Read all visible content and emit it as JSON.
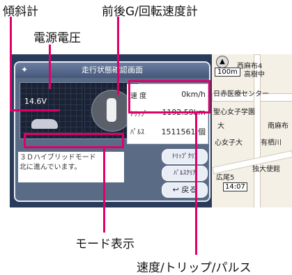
{
  "callouts": {
    "tilt_meter": "傾斜計",
    "g_meter": "前後G/回転速度計",
    "voltage": "電源電圧",
    "mode_display": "モード表示",
    "speed_trip_pulse": "速度/トリップ/パルス"
  },
  "panel": {
    "title": "走行状態確認画面",
    "voltage_value": "14.6V",
    "speed_label": "速 度",
    "speed_value": "0km/h",
    "trip_label": "ﾄﾘｯﾌﾟ",
    "trip_value": "1192.59km",
    "pulse_label": "ﾊﾟﾙｽ",
    "pulse_value": "1511561 個",
    "mode_line1": "３Ｄハイブリッドモード",
    "mode_line2": "北に進んでいます。",
    "trip_clear_button": "ﾄﾘｯﾌﾟｸﾘｱ",
    "pulse_clear_button": "ﾊﾟﾙｽｸﾘｱ",
    "back_button": "戻る"
  },
  "map": {
    "labels": [
      "西麻布4",
      "高樹中",
      "日赤医療センター",
      "聖心女子学園",
      "大",
      "南麻布",
      "心女子大",
      "有栖川",
      "独大使館",
      "広尾5"
    ],
    "scale": "100m",
    "time": "14:07"
  },
  "colors": {
    "callout_line": "#e0006a",
    "panel_bg": "#5a6b86"
  }
}
